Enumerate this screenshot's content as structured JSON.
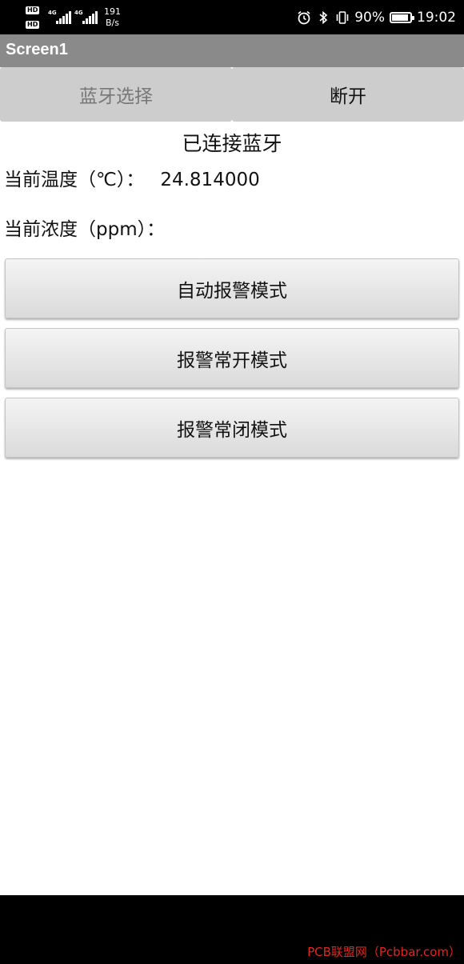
{
  "status_bar": {
    "hd_badge": "HD",
    "network_1": "4G",
    "network_2": "4G",
    "speed_value": "191",
    "speed_unit": "B/s",
    "battery_percent": "90%",
    "battery_level": 0.9,
    "time": "19:02",
    "icons": [
      "alarm-icon",
      "bluetooth-icon",
      "vibrate-icon",
      "battery-icon"
    ]
  },
  "app": {
    "title": "Screen1"
  },
  "top_buttons": {
    "select_bluetooth": "蓝牙选择",
    "disconnect": "断开"
  },
  "connection_status": "已连接蓝牙",
  "readings": {
    "temperature_label": "当前温度（℃）：",
    "temperature_value": "24.814000",
    "concentration_label": "当前浓度（ppm）：",
    "concentration_value": ""
  },
  "mode_buttons": {
    "auto_alarm": "自动报警模式",
    "always_on": "报警常开模式",
    "always_off": "报警常闭模式"
  },
  "watermark": "PCB联盟网（Pcbbar.com）",
  "colors": {
    "title_bar": "#8a8a8a",
    "top_button_bg": "#cdcdcd",
    "watermark": "#e0261d"
  }
}
